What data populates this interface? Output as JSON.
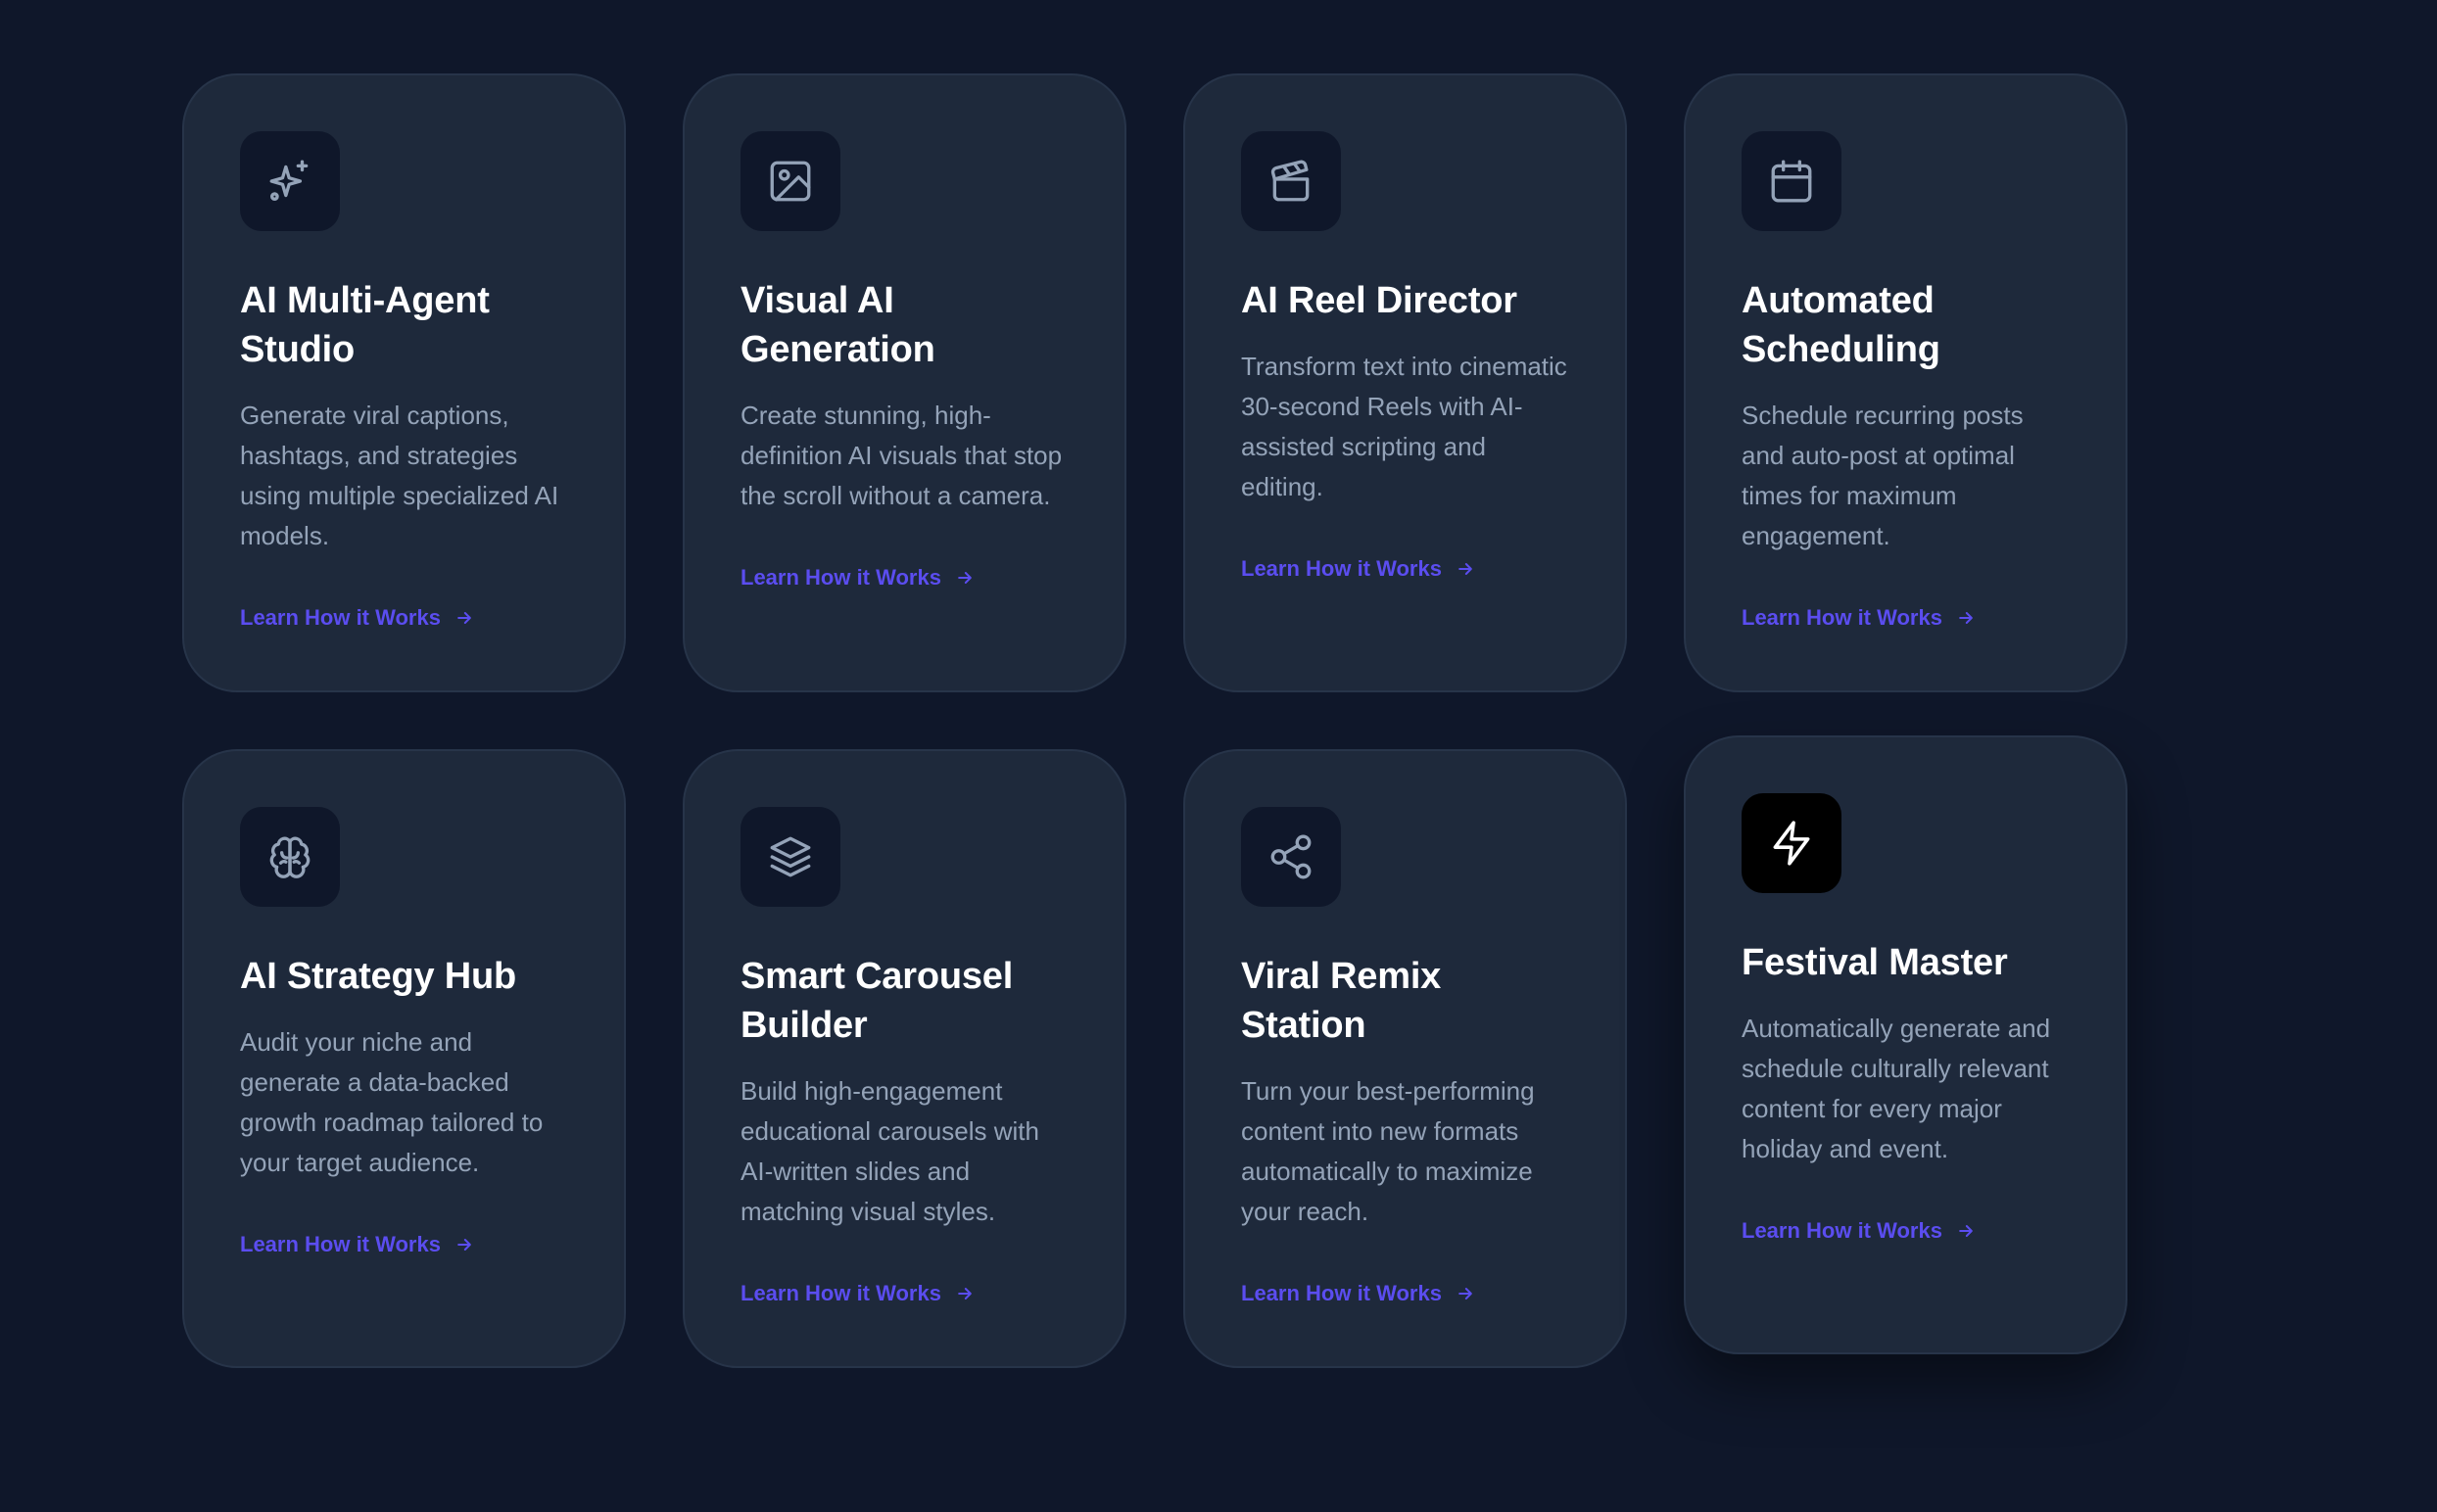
{
  "colors": {
    "background": "#0f172a",
    "card": "#1e293b",
    "title": "#ffffff",
    "description": "#94a3b8",
    "link": "#5b4df0",
    "icon": "#94a3b8"
  },
  "cards": [
    {
      "icon": "sparkles-icon",
      "title": "AI Multi-Agent Studio",
      "description": "Generate viral captions, hashtags, and strategies using multiple specialized AI models.",
      "link": "Learn How it Works"
    },
    {
      "icon": "image-icon",
      "title": "Visual AI Generation",
      "description": "Create stunning, high-definition AI visuals that stop the scroll without a camera.",
      "link": "Learn How it Works"
    },
    {
      "icon": "clapperboard-icon",
      "title": "AI Reel Director",
      "description": "Transform text into cinematic 30-second Reels with AI-assisted scripting and editing.",
      "link": "Learn How it Works"
    },
    {
      "icon": "calendar-icon",
      "title": "Automated Scheduling",
      "description": "Schedule recurring posts and auto-post at optimal times for maximum engagement.",
      "link": "Learn How it Works"
    },
    {
      "icon": "brain-icon",
      "title": "AI Strategy Hub",
      "description": "Audit your niche and generate a data-backed growth roadmap tailored to your target audience.",
      "link": "Learn How it Works"
    },
    {
      "icon": "layers-icon",
      "title": "Smart Carousel Builder",
      "description": "Build high-engagement educational carousels with AI-written slides and matching visual styles.",
      "link": "Learn How it Works"
    },
    {
      "icon": "share-icon",
      "title": "Viral Remix Station",
      "description": "Turn your best-performing content into new formats automatically to maximize your reach.",
      "link": "Learn How it Works"
    },
    {
      "icon": "lightning-icon",
      "title": "Festival Master",
      "description": "Automatically generate and schedule culturally relevant content for every major holiday and event.",
      "link": "Learn How it Works"
    }
  ]
}
